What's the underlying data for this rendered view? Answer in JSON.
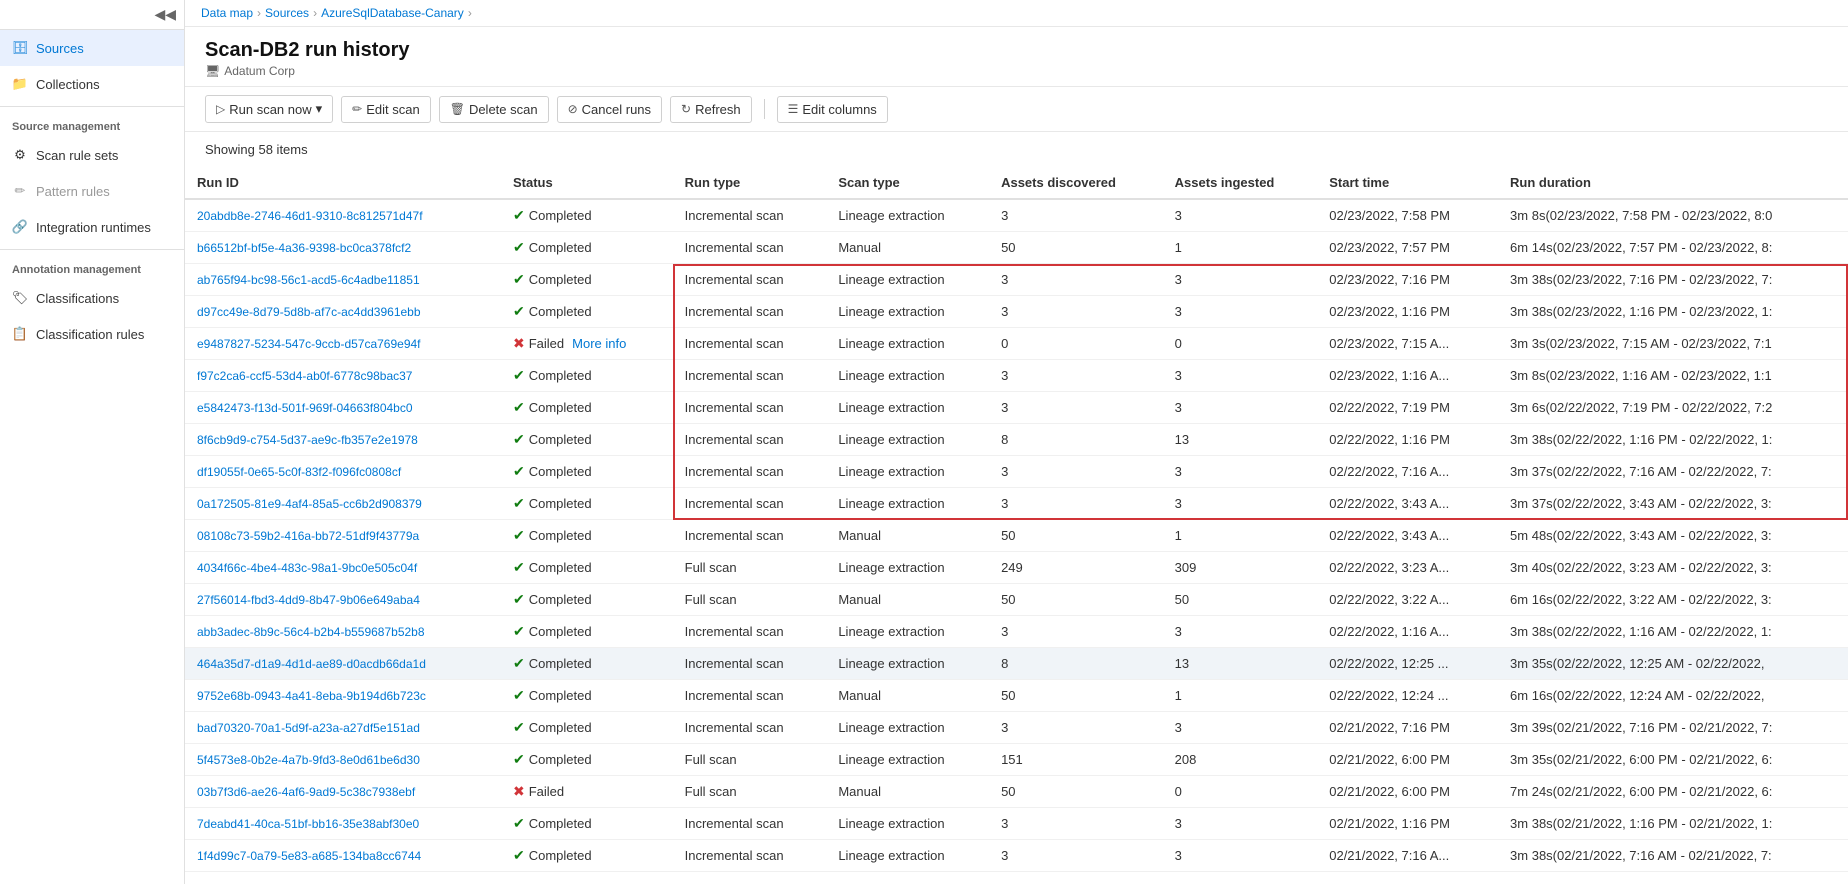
{
  "sidebar": {
    "collapse_title": "Collapse",
    "nav_items": [
      {
        "id": "sources",
        "label": "Sources",
        "icon": "🗄",
        "active": true
      },
      {
        "id": "collections",
        "label": "Collections",
        "icon": "📁",
        "active": false
      }
    ],
    "sections": [
      {
        "label": "Source management",
        "items": [
          {
            "id": "scan-rule-sets",
            "label": "Scan rule sets",
            "icon": "⚙"
          },
          {
            "id": "pattern-rules",
            "label": "Pattern rules",
            "icon": "✏",
            "disabled": true
          },
          {
            "id": "integration-runtimes",
            "label": "Integration runtimes",
            "icon": "🔗"
          }
        ]
      },
      {
        "label": "Annotation management",
        "items": [
          {
            "id": "classifications",
            "label": "Classifications",
            "icon": "🏷"
          },
          {
            "id": "classification-rules",
            "label": "Classification rules",
            "icon": "📋"
          }
        ]
      }
    ]
  },
  "breadcrumb": {
    "items": [
      "Data map",
      "Sources",
      "AzureSqlDatabase-Canary"
    ]
  },
  "page": {
    "title": "Scan-DB2 run history",
    "subtitle_icon": "🖥",
    "subtitle": "Adatum Corp"
  },
  "toolbar": {
    "run_scan_label": "Run scan now",
    "edit_scan_label": "Edit scan",
    "delete_scan_label": "Delete scan",
    "cancel_runs_label": "Cancel runs",
    "refresh_label": "Refresh",
    "edit_columns_label": "Edit columns"
  },
  "table": {
    "showing_label": "Showing 58 items",
    "columns": [
      "Run ID",
      "Status",
      "Run type",
      "Scan type",
      "Assets discovered",
      "Assets ingested",
      "Start time",
      "Run duration"
    ],
    "rows": [
      {
        "id": "20abdb8e-2746-46d1-9310-8c812571d47f",
        "status": "Completed",
        "run_type": "Incremental scan",
        "scan_type": "Lineage extraction",
        "assets_discovered": "3",
        "assets_ingested": "3",
        "start_time": "02/23/2022, 7:58 PM",
        "run_duration": "3m 8s(02/23/2022, 7:58 PM - 02/23/2022, 8:0",
        "selected": false,
        "red_outline": false,
        "failed": false
      },
      {
        "id": "b66512bf-bf5e-4a36-9398-bc0ca378fcf2",
        "status": "Completed",
        "run_type": "Incremental scan",
        "scan_type": "Manual",
        "assets_discovered": "50",
        "assets_ingested": "1",
        "start_time": "02/23/2022, 7:57 PM",
        "run_duration": "6m 14s(02/23/2022, 7:57 PM - 02/23/2022, 8:",
        "selected": false,
        "red_outline": false,
        "failed": false
      },
      {
        "id": "ab765f94-bc98-56c1-acd5-6c4adbe11851",
        "status": "Completed",
        "run_type": "Incremental scan",
        "scan_type": "Lineage extraction",
        "assets_discovered": "3",
        "assets_ingested": "3",
        "start_time": "02/23/2022, 7:16 PM",
        "run_duration": "3m 38s(02/23/2022, 7:16 PM - 02/23/2022, 7:",
        "selected": false,
        "red_outline": true,
        "failed": false
      },
      {
        "id": "d97cc49e-8d79-5d8b-af7c-ac4dd3961ebb",
        "status": "Completed",
        "run_type": "Incremental scan",
        "scan_type": "Lineage extraction",
        "assets_discovered": "3",
        "assets_ingested": "3",
        "start_time": "02/23/2022, 1:16 PM",
        "run_duration": "3m 38s(02/23/2022, 1:16 PM - 02/23/2022, 1:",
        "selected": false,
        "red_outline": true,
        "failed": false
      },
      {
        "id": "e9487827-5234-547c-9ccb-d57ca769e94f",
        "status": "Failed",
        "more_info": "More info",
        "run_type": "Incremental scan",
        "scan_type": "Lineage extraction",
        "assets_discovered": "0",
        "assets_ingested": "0",
        "start_time": "02/23/2022, 7:15 A...",
        "run_duration": "3m 3s(02/23/2022, 7:15 AM - 02/23/2022, 7:1",
        "selected": false,
        "red_outline": true,
        "failed": true
      },
      {
        "id": "f97c2ca6-ccf5-53d4-ab0f-6778c98bac37",
        "status": "Completed",
        "run_type": "Incremental scan",
        "scan_type": "Lineage extraction",
        "assets_discovered": "3",
        "assets_ingested": "3",
        "start_time": "02/23/2022, 1:16 A...",
        "run_duration": "3m 8s(02/23/2022, 1:16 AM - 02/23/2022, 1:1",
        "selected": false,
        "red_outline": true,
        "failed": false
      },
      {
        "id": "e5842473-f13d-501f-969f-04663f804bc0",
        "status": "Completed",
        "run_type": "Incremental scan",
        "scan_type": "Lineage extraction",
        "assets_discovered": "3",
        "assets_ingested": "3",
        "start_time": "02/22/2022, 7:19 PM",
        "run_duration": "3m 6s(02/22/2022, 7:19 PM - 02/22/2022, 7:2",
        "selected": false,
        "red_outline": true,
        "failed": false
      },
      {
        "id": "8f6cb9d9-c754-5d37-ae9c-fb357e2e1978",
        "status": "Completed",
        "run_type": "Incremental scan",
        "scan_type": "Lineage extraction",
        "assets_discovered": "8",
        "assets_ingested": "13",
        "start_time": "02/22/2022, 1:16 PM",
        "run_duration": "3m 38s(02/22/2022, 1:16 PM - 02/22/2022, 1:",
        "selected": false,
        "red_outline": true,
        "failed": false
      },
      {
        "id": "df19055f-0e65-5c0f-83f2-f096fc0808cf",
        "status": "Completed",
        "run_type": "Incremental scan",
        "scan_type": "Lineage extraction",
        "assets_discovered": "3",
        "assets_ingested": "3",
        "start_time": "02/22/2022, 7:16 A...",
        "run_duration": "3m 37s(02/22/2022, 7:16 AM - 02/22/2022, 7:",
        "selected": false,
        "red_outline": true,
        "failed": false
      },
      {
        "id": "0a172505-81e9-4af4-85a5-cc6b2d908379",
        "status": "Completed",
        "run_type": "Incremental scan",
        "scan_type": "Lineage extraction",
        "assets_discovered": "3",
        "assets_ingested": "3",
        "start_time": "02/22/2022, 3:43 A...",
        "run_duration": "3m 37s(02/22/2022, 3:43 AM - 02/22/2022, 3:",
        "selected": false,
        "red_outline": true,
        "failed": false
      },
      {
        "id": "08108c73-59b2-416a-bb72-51df9f43779a",
        "status": "Completed",
        "run_type": "Incremental scan",
        "scan_type": "Manual",
        "assets_discovered": "50",
        "assets_ingested": "1",
        "start_time": "02/22/2022, 3:43 A...",
        "run_duration": "5m 48s(02/22/2022, 3:43 AM - 02/22/2022, 3:",
        "selected": false,
        "red_outline": false,
        "failed": false
      },
      {
        "id": "4034f66c-4be4-483c-98a1-9bc0e505c04f",
        "status": "Completed",
        "run_type": "Full scan",
        "scan_type": "Lineage extraction",
        "assets_discovered": "249",
        "assets_ingested": "309",
        "start_time": "02/22/2022, 3:23 A...",
        "run_duration": "3m 40s(02/22/2022, 3:23 AM - 02/22/2022, 3:",
        "selected": false,
        "red_outline": false,
        "failed": false
      },
      {
        "id": "27f56014-fbd3-4dd9-8b47-9b06e649aba4",
        "status": "Completed",
        "run_type": "Full scan",
        "scan_type": "Manual",
        "assets_discovered": "50",
        "assets_ingested": "50",
        "start_time": "02/22/2022, 3:22 A...",
        "run_duration": "6m 16s(02/22/2022, 3:22 AM - 02/22/2022, 3:",
        "selected": false,
        "red_outline": false,
        "failed": false
      },
      {
        "id": "abb3adec-8b9c-56c4-b2b4-b559687b52b8",
        "status": "Completed",
        "run_type": "Incremental scan",
        "scan_type": "Lineage extraction",
        "assets_discovered": "3",
        "assets_ingested": "3",
        "start_time": "02/22/2022, 1:16 A...",
        "run_duration": "3m 38s(02/22/2022, 1:16 AM - 02/22/2022, 1:",
        "selected": false,
        "red_outline": false,
        "failed": false
      },
      {
        "id": "464a35d7-d1a9-4d1d-ae89-d0acdb66da1d",
        "status": "Completed",
        "run_type": "Incremental scan",
        "scan_type": "Lineage extraction",
        "assets_discovered": "8",
        "assets_ingested": "13",
        "start_time": "02/22/2022, 12:25 ...",
        "run_duration": "3m 35s(02/22/2022, 12:25 AM - 02/22/2022,",
        "selected": true,
        "red_outline": false,
        "failed": false
      },
      {
        "id": "9752e68b-0943-4a41-8eba-9b194d6b723c",
        "status": "Completed",
        "run_type": "Incremental scan",
        "scan_type": "Manual",
        "assets_discovered": "50",
        "assets_ingested": "1",
        "start_time": "02/22/2022, 12:24 ...",
        "run_duration": "6m 16s(02/22/2022, 12:24 AM - 02/22/2022,",
        "selected": false,
        "red_outline": false,
        "failed": false
      },
      {
        "id": "bad70320-70a1-5d9f-a23a-a27df5e151ad",
        "status": "Completed",
        "run_type": "Incremental scan",
        "scan_type": "Lineage extraction",
        "assets_discovered": "3",
        "assets_ingested": "3",
        "start_time": "02/21/2022, 7:16 PM",
        "run_duration": "3m 39s(02/21/2022, 7:16 PM - 02/21/2022, 7:",
        "selected": false,
        "red_outline": false,
        "failed": false
      },
      {
        "id": "5f4573e8-0b2e-4a7b-9fd3-8e0d61be6d30",
        "status": "Completed",
        "run_type": "Full scan",
        "scan_type": "Lineage extraction",
        "assets_discovered": "151",
        "assets_ingested": "208",
        "start_time": "02/21/2022, 6:00 PM",
        "run_duration": "3m 35s(02/21/2022, 6:00 PM - 02/21/2022, 6:",
        "selected": false,
        "red_outline": false,
        "failed": false
      },
      {
        "id": "03b7f3d6-ae26-4af6-9ad9-5c38c7938ebf",
        "status": "Failed",
        "run_type": "Full scan",
        "scan_type": "Manual",
        "assets_discovered": "50",
        "assets_ingested": "0",
        "start_time": "02/21/2022, 6:00 PM",
        "run_duration": "7m 24s(02/21/2022, 6:00 PM - 02/21/2022, 6:",
        "selected": false,
        "red_outline": false,
        "failed": true
      },
      {
        "id": "7deabd41-40ca-51bf-bb16-35e38abf30e0",
        "status": "Completed",
        "run_type": "Incremental scan",
        "scan_type": "Lineage extraction",
        "assets_discovered": "3",
        "assets_ingested": "3",
        "start_time": "02/21/2022, 1:16 PM",
        "run_duration": "3m 38s(02/21/2022, 1:16 PM - 02/21/2022, 1:",
        "selected": false,
        "red_outline": false,
        "failed": false
      },
      {
        "id": "1f4d99c7-0a79-5e83-a685-134ba8cc6744",
        "status": "Completed",
        "run_type": "Incremental scan",
        "scan_type": "Lineage extraction",
        "assets_discovered": "3",
        "assets_ingested": "3",
        "start_time": "02/21/2022, 7:16 A...",
        "run_duration": "3m 38s(02/21/2022, 7:16 AM - 02/21/2022, 7:",
        "selected": false,
        "red_outline": false,
        "failed": false
      }
    ]
  },
  "colors": {
    "link_blue": "#0078d4",
    "success_green": "#107c10",
    "error_red": "#d13438",
    "border_gray": "#e0e0e0",
    "selected_row": "#e8f0fe",
    "red_outline": "#d13438"
  }
}
